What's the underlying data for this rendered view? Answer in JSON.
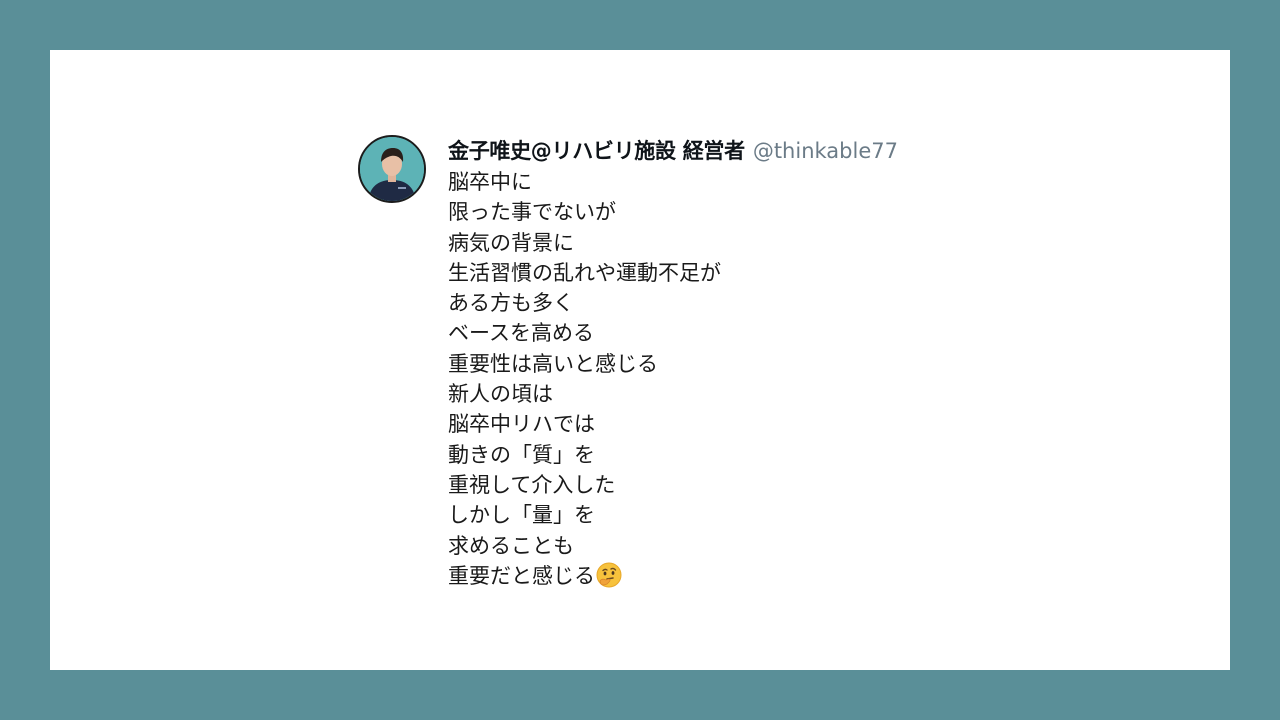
{
  "tweet": {
    "display_name": "金子唯史@リハビリ施設 経営者",
    "handle": "@thinkable77",
    "lines": [
      "脳卒中に",
      "限った事でないが",
      "病気の背景に",
      "生活習慣の乱れや運動不足が",
      "ある方も多く",
      "ベースを高める",
      "重要性は高いと感じる",
      "新人の頃は",
      "脳卒中リハでは",
      "動きの「質」を",
      "重視して介入した",
      "しかし「量」を",
      "求めることも",
      "重要だと感じる"
    ],
    "trailing_emoji": "thinking-face-icon"
  },
  "colors": {
    "background": "#5a8f98",
    "card": "#ffffff",
    "name": "#0f1419",
    "handle": "#6b7b87",
    "text": "#1a1a1a"
  }
}
